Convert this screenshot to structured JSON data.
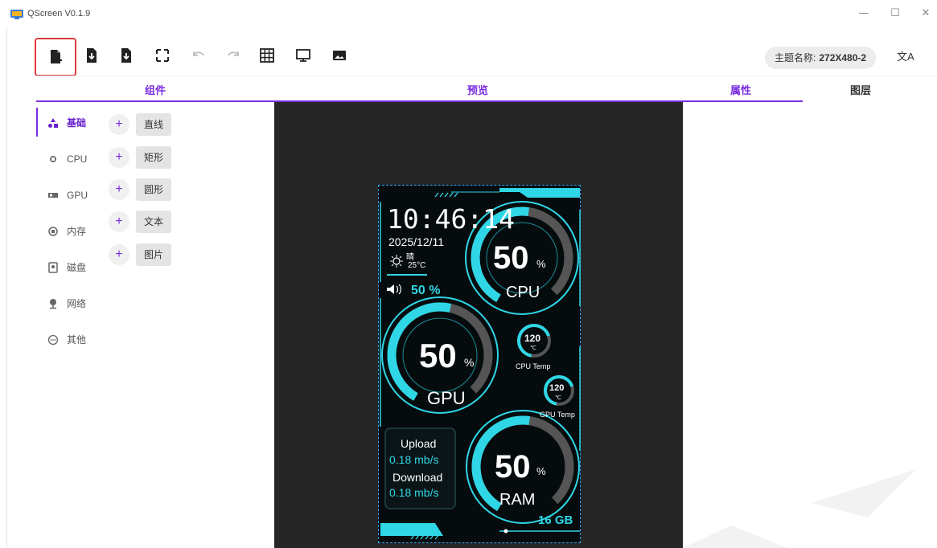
{
  "window": {
    "title": "QScreen V0.1.9",
    "controls": {
      "minimize": "—",
      "maximize": "☐",
      "close": "✕"
    }
  },
  "toolbar": {
    "buttons": [
      "new-file",
      "import-file",
      "export-file",
      "fit-screen",
      "undo",
      "redo",
      "grid",
      "monitor-preview",
      "image"
    ],
    "theme_label": "主题名称:",
    "theme_value": "272X480-2",
    "lang_icon": "文A"
  },
  "panels": {
    "components": "组件",
    "preview": "预览",
    "properties": "属性",
    "layers": "图层"
  },
  "nav": [
    {
      "icon": "shapes-icon",
      "label": "基础",
      "active": true
    },
    {
      "icon": "cpu-icon",
      "label": "CPU",
      "active": false
    },
    {
      "icon": "gpu-icon",
      "label": "GPU",
      "active": false
    },
    {
      "icon": "memory-icon",
      "label": "内存",
      "active": false
    },
    {
      "icon": "disk-icon",
      "label": "磁盘",
      "active": false
    },
    {
      "icon": "network-icon",
      "label": "网络",
      "active": false
    },
    {
      "icon": "more-icon",
      "label": "其他",
      "active": false
    }
  ],
  "components": [
    {
      "plus": "+",
      "label": "直线"
    },
    {
      "plus": "+",
      "label": "矩形"
    },
    {
      "plus": "+",
      "label": "圆形"
    },
    {
      "plus": "+",
      "label": "文本"
    },
    {
      "plus": "+",
      "label": "图片"
    }
  ],
  "device": {
    "time": "10:46:14",
    "date": "2025/12/11",
    "weather": "晴",
    "temperature": "25°C",
    "volume": "50 %",
    "cpu": {
      "value": "50",
      "unit": "%",
      "label": "CPU"
    },
    "gpu": {
      "value": "50",
      "unit": "%",
      "label": "GPU"
    },
    "ram": {
      "value": "50",
      "unit": "%",
      "label": "RAM",
      "size": "16 GB"
    },
    "cpu_temp": {
      "value": "120",
      "unit": "℃",
      "label": "CPU Temp"
    },
    "gpu_temp": {
      "value": "120",
      "unit": "℃",
      "label": "GPU Temp"
    },
    "upload_label": "Upload",
    "upload_value": "0.18 mb/s",
    "download_label": "Download",
    "download_value": "0.18 mb/s"
  },
  "colors": {
    "accent": "#7a2ee0",
    "gauge": "#2fd6e6",
    "preview_bg": "#262626",
    "highlight": "#e03b3b"
  }
}
